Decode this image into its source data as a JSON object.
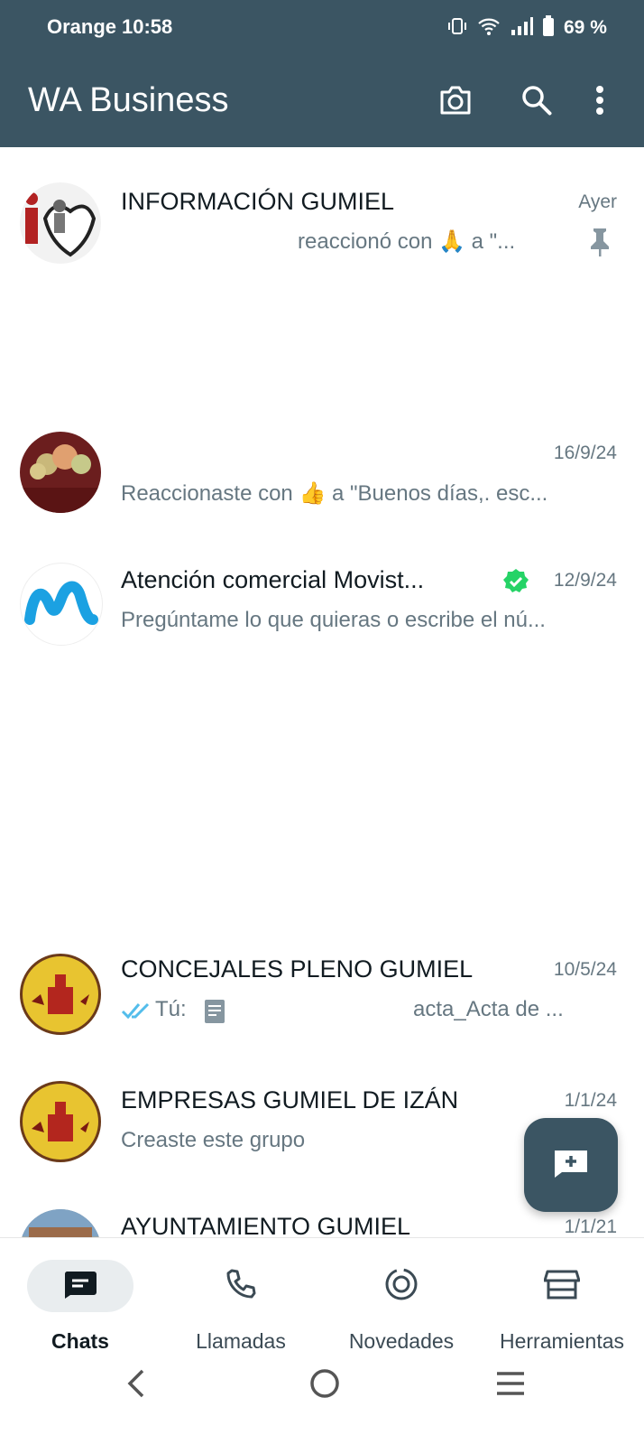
{
  "status_bar": {
    "carrier": "Orange",
    "time": "10:58",
    "battery": "69 %"
  },
  "app_bar": {
    "title": "WA Business",
    "icons": [
      "camera-icon",
      "search-icon",
      "more-vert-icon"
    ]
  },
  "chats": [
    {
      "name": "INFORMACIÓN GUMIEL",
      "time": "Ayer",
      "preview": "reaccionó con 🙏 a \"...",
      "pinned": true
    },
    {
      "name": "",
      "time": "16/9/24",
      "preview": "Reaccionaste con 👍 a \"Buenos días,. esc..."
    },
    {
      "name": "Atención comercial Movist...",
      "time": "12/9/24",
      "verified": true,
      "preview": "Pregúntame lo que quieras o escribe el nú..."
    },
    {
      "name": "CONCEJALES PLENO GUMIEL",
      "time": "10/5/24",
      "preview_prefix": "Tú:",
      "preview": "acta_Acta de ..."
    },
    {
      "name": "EMPRESAS GUMIEL DE IZÁN",
      "time": "1/1/24",
      "preview": "Creaste este grupo"
    },
    {
      "name": "AYUNTAMIENTO GUMIEL",
      "time": "1/1/21",
      "preview": ""
    }
  ],
  "fab": {
    "icon": "new-chat-icon"
  },
  "bottom_nav": [
    {
      "label": "Chats",
      "icon": "chats-icon",
      "active": true
    },
    {
      "label": "Llamadas",
      "icon": "phone-icon",
      "active": false
    },
    {
      "label": "Novedades",
      "icon": "updates-icon",
      "active": false
    },
    {
      "label": "Herramientas",
      "icon": "store-icon",
      "active": false
    }
  ],
  "colors": {
    "appbar": "#3b5563",
    "verified": "#25d366",
    "read_ticks": "#53bdeb"
  }
}
